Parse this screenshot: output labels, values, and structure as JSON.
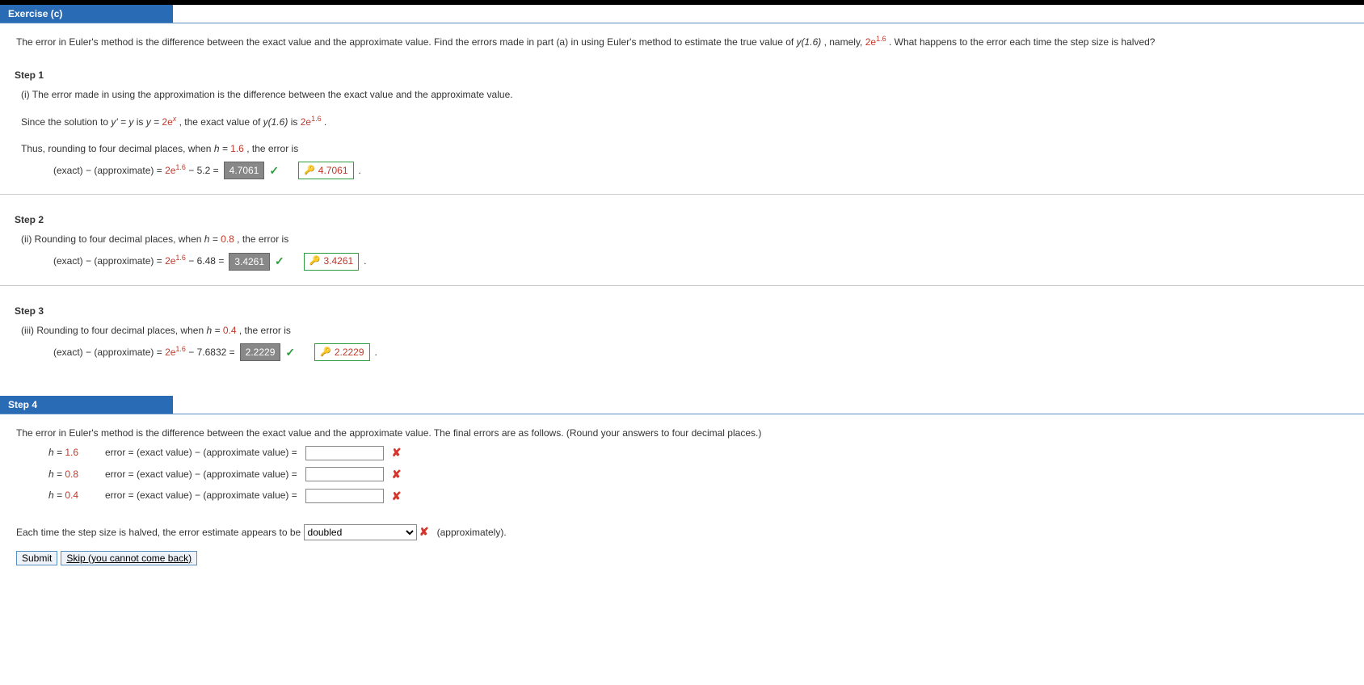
{
  "header": {
    "title": "Exercise (c)"
  },
  "prompt": {
    "p1a": "The error in Euler's method is the difference between the exact value and the approximate value. Find the errors made in part (a) in using Euler's method to estimate the true value of ",
    "p1b": "y(1.6)",
    "p1c": ", namely, ",
    "p1d": "2e",
    "p1d_sup": "1.6",
    "p1e": ". What happens to the error each time the step size is halved?"
  },
  "step1": {
    "title": "Step 1",
    "line1": "(i) The error made in using the approximation is the difference between the exact value and the approximate value.",
    "line2a": "Since the solution to ",
    "line2b": "y' = y",
    "line2c": " is ",
    "line2d": "y = ",
    "line2e": "2e",
    "line2e_sup": "x",
    "line2f": ", the exact value of ",
    "line2g": "y(1.6)",
    "line2h": " is ",
    "line2i": "2e",
    "line2i_sup": "1.6",
    "line2j": ".",
    "line3a": "Thus, rounding to four decimal places, when ",
    "line3b": "h = ",
    "line3c": "1.6",
    "line3d": ", the error is",
    "eq_lhs": "(exact) − (approximate) = ",
    "eq_rhs1": "2e",
    "eq_rhs1_sup": "1.6",
    "eq_rhs2": " − 5.2 = ",
    "answer": "4.7061",
    "hint": "4.7061"
  },
  "step2": {
    "title": "Step 2",
    "line1a": "(ii) Rounding to four decimal places, when ",
    "line1b": "h = ",
    "line1c": "0.8",
    "line1d": ", the error is",
    "eq_lhs": "(exact) − (approximate) = ",
    "eq_rhs1": "2e",
    "eq_rhs1_sup": "1.6",
    "eq_rhs2": " − 6.48 = ",
    "answer": "3.4261",
    "hint": "3.4261"
  },
  "step3": {
    "title": "Step 3",
    "line1a": "(iii) Rounding to four decimal places, when ",
    "line1b": "h = ",
    "line1c": "0.4",
    "line1d": ", the error is",
    "eq_lhs": "(exact) − (approximate) = ",
    "eq_rhs1": "2e",
    "eq_rhs1_sup": "1.6",
    "eq_rhs2": " − 7.6832 = ",
    "answer": "2.2229",
    "hint": "2.2229"
  },
  "step4": {
    "title": "Step 4",
    "intro": "The error in Euler's method is the difference between the exact value and the approximate value. The final errors are as follows. (Round your answers to four decimal places.)",
    "rows": [
      {
        "h_lhs": "h = ",
        "h_val": "1.6",
        "label": "error = (exact value) − (approximate value) = "
      },
      {
        "h_lhs": "h = ",
        "h_val": "0.8",
        "label": "error = (exact value) − (approximate value) = "
      },
      {
        "h_lhs": "h = ",
        "h_val": "0.4",
        "label": "error = (exact value) − (approximate value) = "
      }
    ],
    "final_a": "Each time the step size is halved, the error estimate appears to be ",
    "select_value": "doubled",
    "final_b": "(approximately)."
  },
  "buttons": {
    "submit": "Submit",
    "skip": "Skip (you cannot come back)"
  },
  "period": " ."
}
